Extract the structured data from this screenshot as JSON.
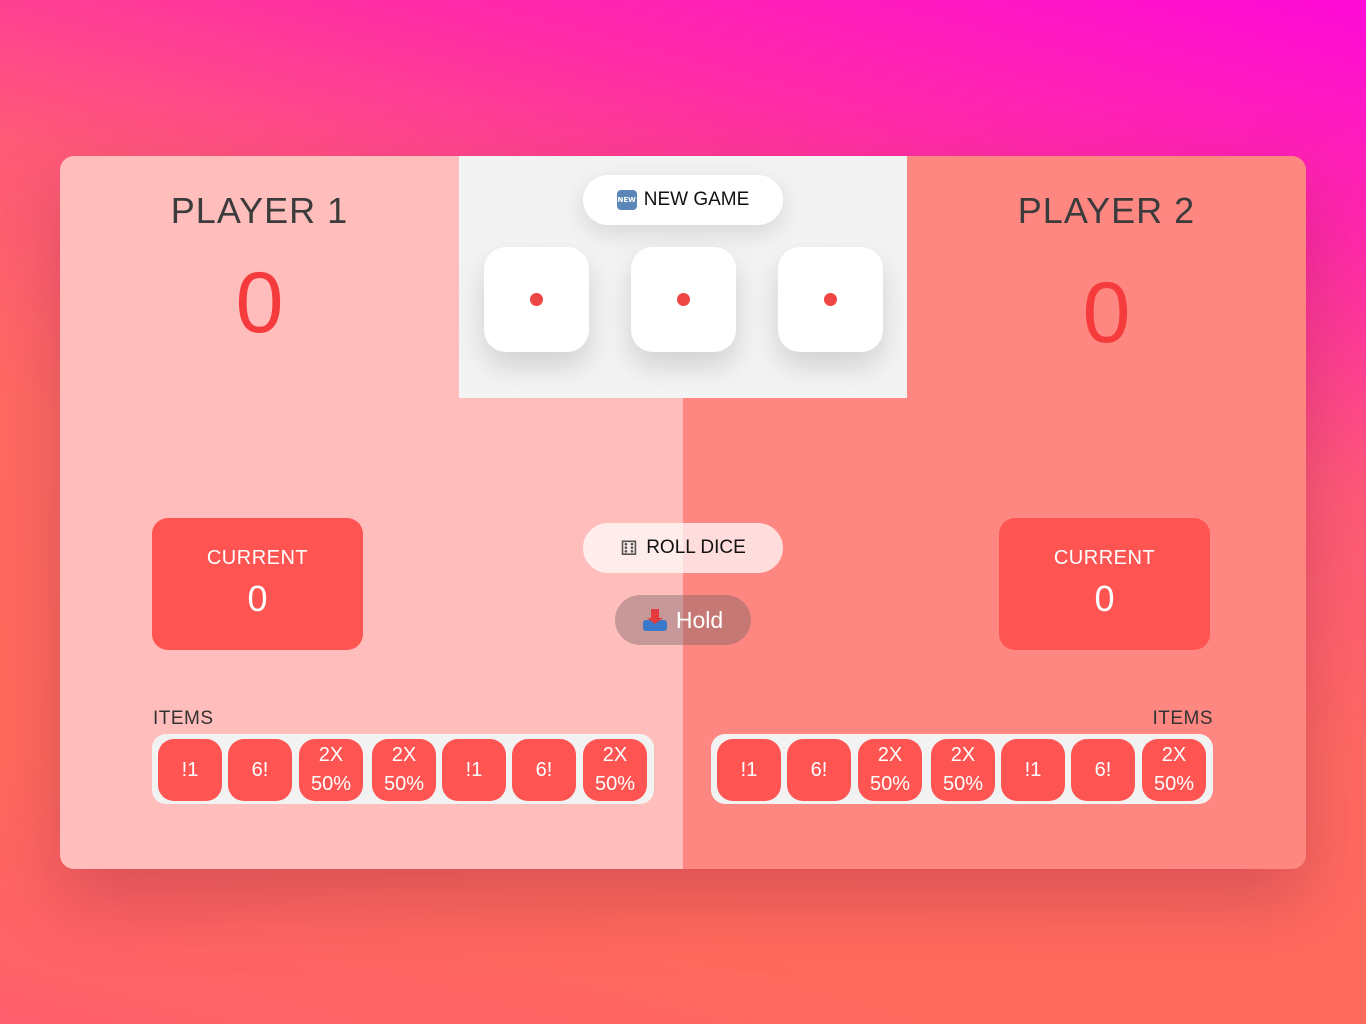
{
  "game": {
    "new_game_label": "NEW GAME",
    "new_game_icon": "new-button-icon",
    "roll_label": "ROLL DICE",
    "roll_icon": "game-die-icon",
    "hold_label": "Hold",
    "hold_icon": "inbox-tray-icon",
    "dice": [
      1,
      1,
      1
    ]
  },
  "players": [
    {
      "name": "PLAYER 1",
      "score": "0",
      "current_label": "CURRENT",
      "current": "0",
      "items_label": "ITEMS",
      "items": [
        {
          "line1": "!1",
          "line2": ""
        },
        {
          "line1": "6!",
          "line2": ""
        },
        {
          "line1": "2X",
          "line2": "50%"
        },
        {
          "line1": "2X",
          "line2": "50%"
        },
        {
          "line1": "!1",
          "line2": ""
        },
        {
          "line1": "6!",
          "line2": ""
        },
        {
          "line1": "2X",
          "line2": "50%"
        }
      ]
    },
    {
      "name": "PLAYER 2",
      "score": "0",
      "current_label": "CURRENT",
      "current": "0",
      "items_label": "ITEMS",
      "items": [
        {
          "line1": "!1",
          "line2": ""
        },
        {
          "line1": "6!",
          "line2": ""
        },
        {
          "line1": "2X",
          "line2": "50%"
        },
        {
          "line1": "2X",
          "line2": "50%"
        },
        {
          "line1": "!1",
          "line2": ""
        },
        {
          "line1": "6!",
          "line2": ""
        },
        {
          "line1": "2X",
          "line2": "50%"
        }
      ]
    }
  ],
  "colors": {
    "player1_bg": "#ffbdbc",
    "player2_bg": "#ff8782",
    "accent": "#ff5552",
    "score": "#f53b3b",
    "center_panel": "#f3f3f3"
  }
}
